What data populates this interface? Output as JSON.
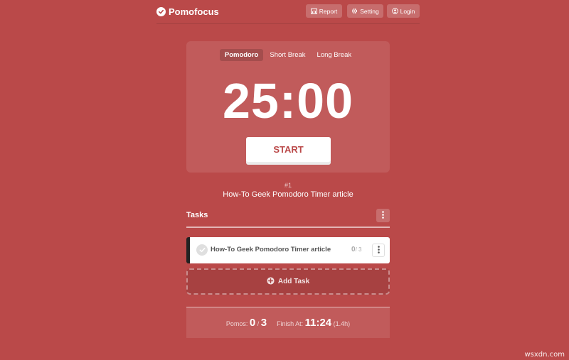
{
  "app": {
    "name": "Pomofocus",
    "accent_color": "#ba4949"
  },
  "header": {
    "report_label": "Report",
    "setting_label": "Setting",
    "login_label": "Login"
  },
  "timer": {
    "modes": [
      "Pomodoro",
      "Short Break",
      "Long Break"
    ],
    "active_mode": "Pomodoro",
    "time": "25:00",
    "start_label": "START"
  },
  "current": {
    "number": "#1",
    "task": "How-To Geek Pomodoro Timer article"
  },
  "tasks": {
    "title": "Tasks",
    "items": [
      {
        "title": "How-To Geek Pomodoro Timer article",
        "done": "0",
        "total": "/ 3"
      }
    ],
    "add_label": "Add Task"
  },
  "summary": {
    "pomos_label": "Pomos:",
    "pomos_done": "0",
    "pomos_total": "3",
    "finish_label": "Finish At:",
    "finish_time": "11:24",
    "finish_duration": "(1.4h)"
  },
  "watermark": "wsxdn.com"
}
